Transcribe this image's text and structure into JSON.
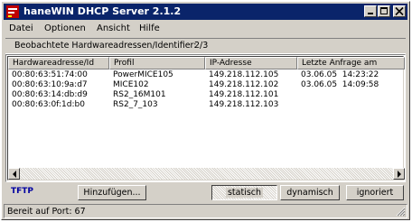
{
  "window": {
    "title": "haneWIN DHCP Server 2.1.2"
  },
  "titlebar": {
    "minimize": "_",
    "maximize": "□",
    "close": "×"
  },
  "menu": {
    "items": [
      "Datei",
      "Optionen",
      "Ansicht",
      "Hilfe"
    ]
  },
  "observed": {
    "label": "Beobachtete Hardwareadressen/Identifier:",
    "count": "2/3"
  },
  "table": {
    "columns": [
      "Hardwareadresse/Id",
      "Profil",
      "IP-Adresse",
      "Letzte Anfrage am"
    ],
    "rows": [
      [
        "00:80:63:51:74:00",
        "PowerMICE105",
        "149.218.112.105",
        "03.06.05  14:23:22"
      ],
      [
        "00:80:63:10:9a:d7",
        "MICE102",
        "149.218.112.102",
        "03.06.05  14:09:58"
      ],
      [
        "00:80:63:14:db:d9",
        "RS2_16M101",
        "149.218.112.101",
        ""
      ],
      [
        "00:80:63:0f:1d:b0",
        "RS2_7_103",
        "149.218.112.103",
        ""
      ]
    ]
  },
  "toolbar": {
    "tftp": "TFTP",
    "add": "Hinzufügen...",
    "static": "statisch",
    "dynamic": "dynamisch",
    "ignored": "ignoriert"
  },
  "status": {
    "text": "Bereit auf Port: 67"
  },
  "colors": {
    "titlebar": "#0a246a",
    "face": "#d4d0c8",
    "tftp": "#0000a0"
  }
}
